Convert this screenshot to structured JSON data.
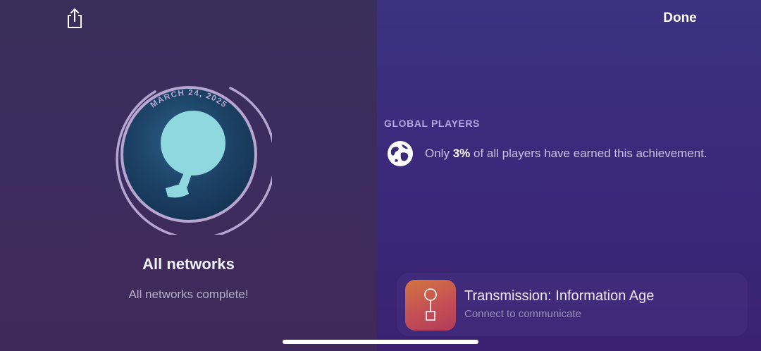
{
  "toolbar": {
    "share_icon": "share-icon",
    "done_label": "Done"
  },
  "achievement": {
    "date": "MARCH 24, 2025",
    "badge_icon": "balloon-icon",
    "title": "All networks",
    "description": "All networks complete!"
  },
  "global_players": {
    "heading": "GLOBAL PLAYERS",
    "icon": "globe-icon",
    "prefix": "Only ",
    "percent": "3%",
    "suffix": " of all players have earned this achievement."
  },
  "game_card": {
    "icon": "transmission-app-icon",
    "title": "Transmission: Information Age",
    "subtitle": "Connect to communicate"
  },
  "colors": {
    "left_bg": "#3d2c5e",
    "right_bg": "#3b2a7c",
    "badge_accent": "#8fd8e0",
    "ring": "#b7a6d2"
  }
}
